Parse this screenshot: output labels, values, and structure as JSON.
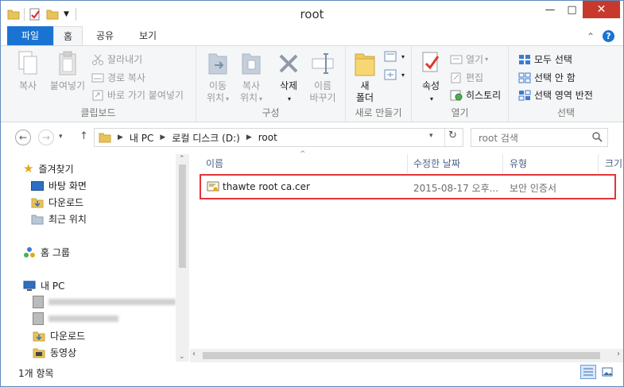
{
  "window": {
    "title": "root",
    "controls": {
      "minimize": "—",
      "maximize": "□",
      "close": "✕"
    }
  },
  "ribbon_tabs": [
    "파일",
    "홈",
    "공유",
    "보기"
  ],
  "ribbon": {
    "clipboard": {
      "label": "클립보드",
      "copy": "복사",
      "paste": "붙여넣기",
      "cut": "잘라내기",
      "copy_path": "경로 복사",
      "paste_shortcut": "바로 가기 붙여넣기"
    },
    "organize": {
      "label": "구성",
      "move_to_1": "이동",
      "move_to_2": "위치",
      "copy_to_1": "복사",
      "copy_to_2": "위치",
      "delete": "삭제",
      "rename_1": "이름",
      "rename_2": "바꾸기"
    },
    "new": {
      "label": "새로 만들기",
      "new_folder_1": "새",
      "new_folder_2": "폴더"
    },
    "open": {
      "label": "열기",
      "properties": "속성",
      "open": "열기",
      "edit": "편집",
      "history": "히스토리"
    },
    "select": {
      "label": "선택",
      "select_all": "모두 선택",
      "select_none": "선택 안 함",
      "invert": "선택 영역 반전"
    }
  },
  "address": {
    "crumbs": [
      "내 PC",
      "로컬 디스크 (D:)",
      "root"
    ],
    "search_placeholder": "root 검색"
  },
  "nav": {
    "favorites": "즐겨찾기",
    "desktop": "바탕 화면",
    "downloads": "다운로드",
    "recent": "최근 위치",
    "homegroup": "홈 그룹",
    "this_pc": "내 PC",
    "downloads2": "다운로드",
    "videos": "동영상"
  },
  "columns": [
    "이름",
    "수정한 날짜",
    "유형",
    "크기"
  ],
  "files": [
    {
      "name": "thawte root ca.cer",
      "modified": "2015-08-17 오후...",
      "type": "보안 인증서"
    }
  ],
  "status": {
    "item_count": "1개 항목"
  },
  "colors": {
    "accent": "#1a73d2",
    "close": "#c7392d",
    "highlight": "#e33438"
  }
}
